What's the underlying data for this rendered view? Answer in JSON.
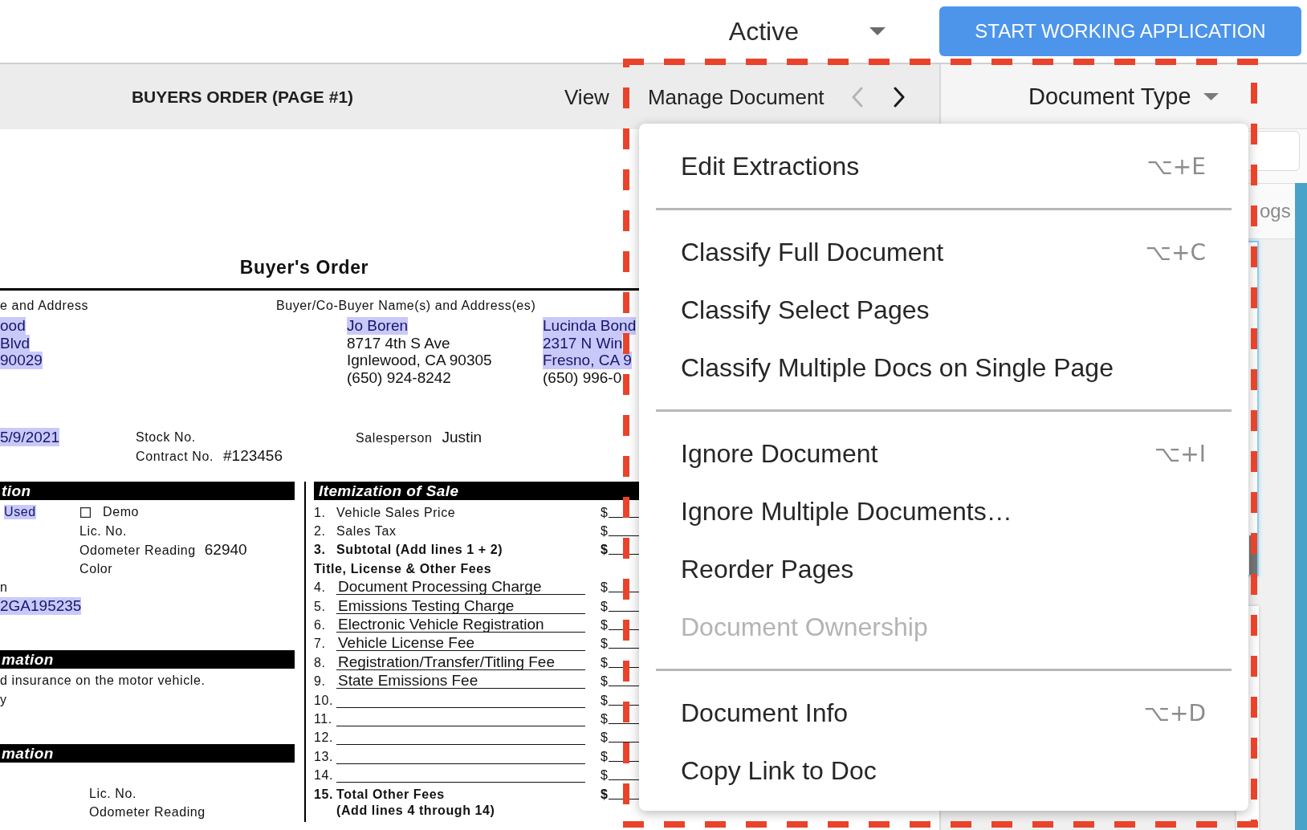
{
  "top_bar": {
    "status": "Active",
    "primary_button": "START WORKING APPLICATION"
  },
  "viewer": {
    "title": "BUYERS ORDER (PAGE #1)",
    "view_button": "View",
    "manage_button": "Manage Document",
    "pager": {
      "previous_disabled": true,
      "next_disabled": false
    }
  },
  "document": {
    "title": "Buyer's Order",
    "seller": {
      "label": "e and Address",
      "lines": [
        {
          "text": "ood",
          "highlighted": true
        },
        {
          "text": "Blvd",
          "highlighted": true
        },
        {
          "text": "90029",
          "highlighted": true
        }
      ]
    },
    "buyers": {
      "label": "Buyer/Co-Buyer Name(s) and Address(es)",
      "people": [
        {
          "lines": [
            {
              "text": "Jo Boren",
              "highlighted": true
            },
            {
              "text": "8717 4th S Ave",
              "highlighted": false
            },
            {
              "text": "Ignlewood, CA 90305",
              "highlighted": false
            },
            {
              "text": "(650) 924-8242",
              "highlighted": false
            }
          ]
        },
        {
          "lines": [
            {
              "text": "Lucinda Bond",
              "highlighted": true
            },
            {
              "text": "2317 N Win",
              "highlighted": true
            },
            {
              "text": "Fresno, CA 9",
              "highlighted": true
            },
            {
              "text": "(650) 996-0",
              "highlighted": false
            }
          ]
        }
      ]
    },
    "date": {
      "text": "5/9/2021",
      "highlighted": true
    },
    "numbers": [
      {
        "label": "Stock No."
      },
      {
        "label": "Contract No.",
        "value": "#123456"
      }
    ],
    "salesperson": {
      "label": "Salesperson",
      "value": "Justin"
    },
    "sections": [
      {
        "header": "tion",
        "rows": [
          {
            "kind": "options",
            "text": "Used",
            "highlighted": true,
            "checkbox_label": "Demo",
            "checked": false
          },
          {
            "kind": "field",
            "label": "Lic. No."
          },
          {
            "kind": "field",
            "label": "Odometer Reading",
            "value": "62940"
          },
          {
            "kind": "field",
            "label": "Color"
          },
          {
            "kind": "text",
            "text": "n",
            "highlighted": false
          },
          {
            "kind": "value",
            "text": "2GA195235",
            "highlighted": true
          }
        ]
      },
      {
        "header": "mation",
        "rows": [
          {
            "kind": "text",
            "text": "d insurance on the motor vehicle.",
            "highlighted": false
          },
          {
            "kind": "text",
            "text": "y",
            "highlighted": false
          }
        ]
      },
      {
        "header": "mation",
        "rows": [
          {
            "kind": "field",
            "label": "Lic. No."
          },
          {
            "kind": "field",
            "label": "Odometer Reading"
          }
        ]
      }
    ],
    "itemization": {
      "header": "Itemization of Sale",
      "rows": [
        {
          "kind": "line",
          "number": "1.",
          "label": "Vehicle Sales Price",
          "currency": "$"
        },
        {
          "kind": "line",
          "number": "2.",
          "label": "Sales Tax",
          "currency": "$"
        },
        {
          "kind": "total",
          "number": "3.",
          "label": "Subtotal (Add lines 1 + 2)",
          "currency": "$"
        },
        {
          "kind": "heading",
          "label": "Title, License & Other Fees"
        },
        {
          "kind": "fee",
          "number": "4.",
          "label": "Document Processing Charge",
          "currency": "$"
        },
        {
          "kind": "fee",
          "number": "5.",
          "label": "Emissions Testing Charge",
          "currency": "$"
        },
        {
          "kind": "fee",
          "number": "6.",
          "label": "Electronic Vehicle Registration",
          "currency": "$"
        },
        {
          "kind": "fee",
          "number": "7.",
          "label": "Vehicle License Fee",
          "currency": "$"
        },
        {
          "kind": "fee",
          "number": "8.",
          "label": "Registration/Transfer/Titling Fee",
          "currency": "$"
        },
        {
          "kind": "fee",
          "number": "9.",
          "label": "State Emissions Fee",
          "currency": "$"
        },
        {
          "kind": "fee",
          "number": "10.",
          "currency": "$"
        },
        {
          "kind": "fee",
          "number": "11.",
          "currency": "$"
        },
        {
          "kind": "fee",
          "number": "12.",
          "currency": "$"
        },
        {
          "kind": "fee",
          "number": "13.",
          "currency": "$"
        },
        {
          "kind": "fee",
          "number": "14.",
          "currency": "$"
        },
        {
          "kind": "total",
          "number": "15.",
          "label": "Total Other Fees",
          "note": "(Add lines 4 through 14)",
          "currency": "$"
        }
      ]
    }
  },
  "manage_menu": {
    "sections": [
      {
        "items": [
          {
            "label": "Edit Extractions",
            "shortcut": "⌥+E",
            "disabled": false
          }
        ]
      },
      {
        "items": [
          {
            "label": "Classify Full Document",
            "shortcut": "⌥+C",
            "disabled": false
          },
          {
            "label": "Classify Select Pages",
            "disabled": false
          },
          {
            "label": "Classify Multiple Docs on Single Page",
            "disabled": false
          }
        ]
      },
      {
        "items": [
          {
            "label": "Ignore Document",
            "shortcut": "⌥+I",
            "disabled": false
          },
          {
            "label": "Ignore Multiple Documents…",
            "disabled": false
          },
          {
            "label": "Reorder Pages",
            "disabled": false
          },
          {
            "label": "Document Ownership",
            "disabled": true
          }
        ]
      },
      {
        "items": [
          {
            "label": "Document Info",
            "shortcut": "⌥+D",
            "disabled": false
          },
          {
            "label": "Copy Link to Doc",
            "disabled": false
          }
        ]
      }
    ]
  },
  "side_panel": {
    "document_type": "Document Type",
    "tab": "ogs"
  }
}
